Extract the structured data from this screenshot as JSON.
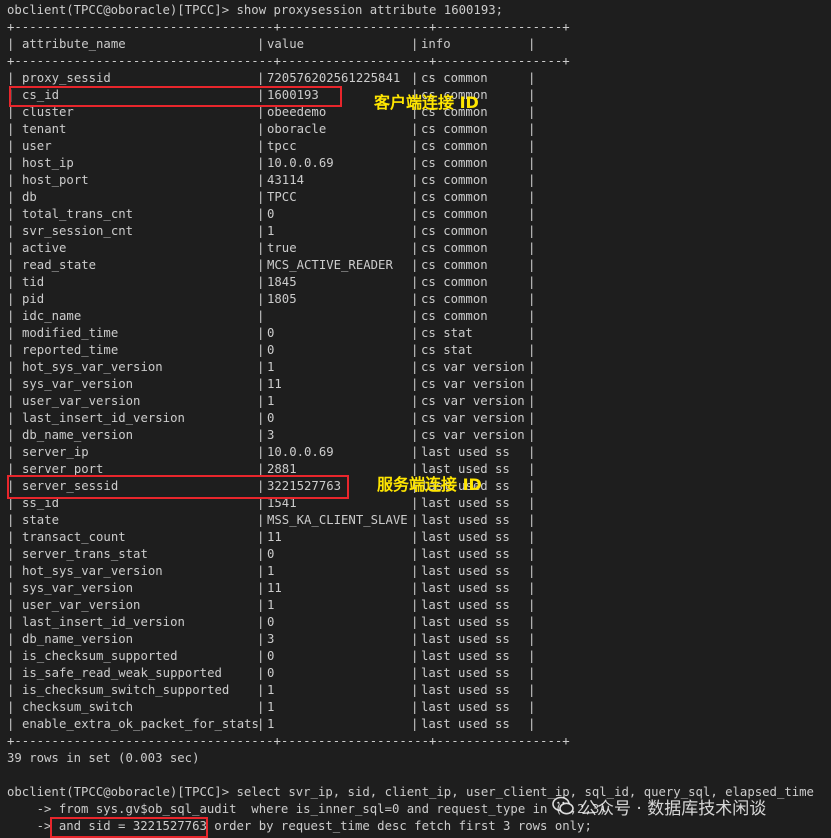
{
  "command_line": "obclient(TPCC@oboracle)[TPCC]> show proxysession attribute 1600193;",
  "border_line": "+-----------------------------------+--------------------+-----------------+",
  "headers": [
    "attribute_name",
    "value",
    "info"
  ],
  "rows": [
    {
      "name": "proxy_sessid",
      "value": "720576202561225841",
      "info": "cs common"
    },
    {
      "name": "cs_id",
      "value": "1600193",
      "info": "cs common"
    },
    {
      "name": "cluster",
      "value": "obeedemo",
      "info": "cs common"
    },
    {
      "name": "tenant",
      "value": "oboracle",
      "info": "cs common"
    },
    {
      "name": "user",
      "value": "tpcc",
      "info": "cs common"
    },
    {
      "name": "host_ip",
      "value": "10.0.0.69",
      "info": "cs common"
    },
    {
      "name": "host_port",
      "value": "43114",
      "info": "cs common"
    },
    {
      "name": "db",
      "value": "TPCC",
      "info": "cs common"
    },
    {
      "name": "total_trans_cnt",
      "value": "0",
      "info": "cs common"
    },
    {
      "name": "svr_session_cnt",
      "value": "1",
      "info": "cs common"
    },
    {
      "name": "active",
      "value": "true",
      "info": "cs common"
    },
    {
      "name": "read_state",
      "value": "MCS_ACTIVE_READER",
      "info": "cs common"
    },
    {
      "name": "tid",
      "value": "1845",
      "info": "cs common"
    },
    {
      "name": "pid",
      "value": "1805",
      "info": "cs common"
    },
    {
      "name": "idc_name",
      "value": "",
      "info": "cs common"
    },
    {
      "name": "modified_time",
      "value": "0",
      "info": "cs stat"
    },
    {
      "name": "reported_time",
      "value": "0",
      "info": "cs stat"
    },
    {
      "name": "hot_sys_var_version",
      "value": "1",
      "info": "cs var version"
    },
    {
      "name": "sys_var_version",
      "value": "11",
      "info": "cs var version"
    },
    {
      "name": "user_var_version",
      "value": "1",
      "info": "cs var version"
    },
    {
      "name": "last_insert_id_version",
      "value": "0",
      "info": "cs var version"
    },
    {
      "name": "db_name_version",
      "value": "3",
      "info": "cs var version"
    },
    {
      "name": "server_ip",
      "value": "10.0.0.69",
      "info": "last used ss"
    },
    {
      "name": "server_port",
      "value": "2881",
      "info": "last used ss"
    },
    {
      "name": "server_sessid",
      "value": "3221527763",
      "info": "last used ss"
    },
    {
      "name": "ss_id",
      "value": "1541",
      "info": "last used ss"
    },
    {
      "name": "state",
      "value": "MSS_KA_CLIENT_SLAVE",
      "info": "last used ss"
    },
    {
      "name": "transact_count",
      "value": "11",
      "info": "last used ss"
    },
    {
      "name": "server_trans_stat",
      "value": "0",
      "info": "last used ss"
    },
    {
      "name": "hot_sys_var_version",
      "value": "1",
      "info": "last used ss"
    },
    {
      "name": "sys_var_version",
      "value": "11",
      "info": "last used ss"
    },
    {
      "name": "user_var_version",
      "value": "1",
      "info": "last used ss"
    },
    {
      "name": "last_insert_id_version",
      "value": "0",
      "info": "last used ss"
    },
    {
      "name": "db_name_version",
      "value": "3",
      "info": "last used ss"
    },
    {
      "name": "is_checksum_supported",
      "value": "0",
      "info": "last used ss"
    },
    {
      "name": "is_safe_read_weak_supported",
      "value": "0",
      "info": "last used ss"
    },
    {
      "name": "is_checksum_switch_supported",
      "value": "1",
      "info": "last used ss"
    },
    {
      "name": "checksum_switch",
      "value": "1",
      "info": "last used ss"
    },
    {
      "name": "enable_extra_ok_packet_for_stats",
      "value": "1",
      "info": "last used ss"
    }
  ],
  "result_summary": "39 rows in set (0.003 sec)",
  "query_lines": [
    "obclient(TPCC@oboracle)[TPCC]> select svr_ip, sid, client_ip, user_client_ip, sql_id, query_sql, elapsed_time",
    "    -> from sys.gv$ob_sql_audit  where is_inner_sql=0 and request_type in (1,2,3)",
    "    -> and sid = 3221527763 order by request_time desc fetch first 3 rows only;"
  ],
  "annotations": {
    "client_id": "客户端连接 ID",
    "server_id": "服务端连接 ID"
  },
  "watermark": "公众号 · 数据库技术闲谈",
  "colors": {
    "background": "#1e1e1e",
    "text": "#cccccc",
    "highlight_box": "#e8262c",
    "annotation": "#ffe600"
  }
}
